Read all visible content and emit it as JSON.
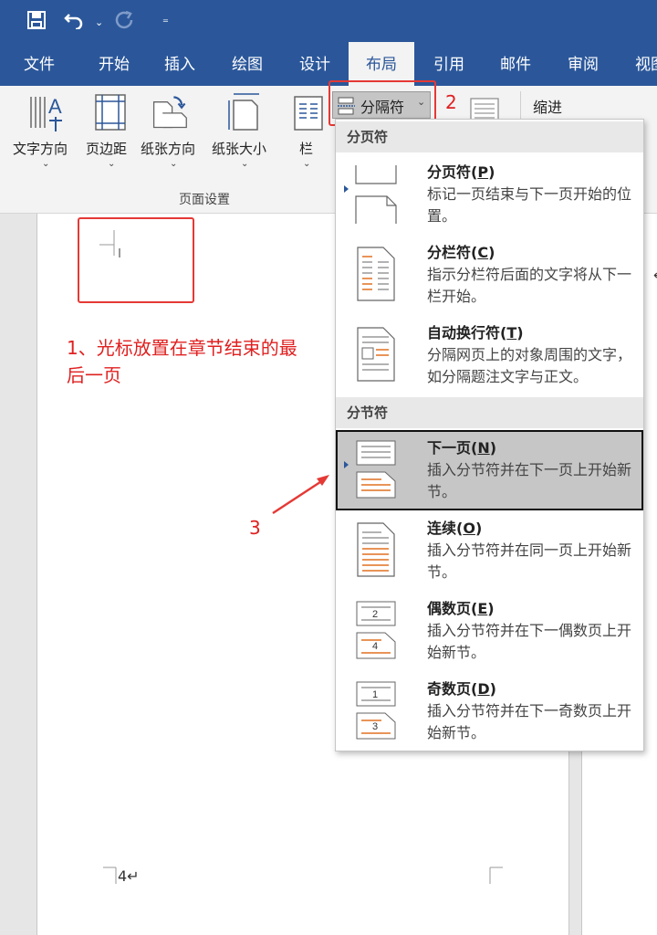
{
  "quick_access": {
    "save_icon": "save-icon",
    "undo_icon": "undo-icon",
    "redo_icon": "redo-icon",
    "customize_icon": "customize-qat-icon"
  },
  "tabs": [
    {
      "label": "文件"
    },
    {
      "label": "开始"
    },
    {
      "label": "插入"
    },
    {
      "label": "绘图"
    },
    {
      "label": "设计"
    },
    {
      "label": "布局"
    },
    {
      "label": "引用"
    },
    {
      "label": "邮件"
    },
    {
      "label": "审阅"
    },
    {
      "label": "视图"
    }
  ],
  "active_tab": "布局",
  "ribbon": {
    "buttons": [
      {
        "label": "文字方向"
      },
      {
        "label": "页边距"
      },
      {
        "label": "纸张方向"
      },
      {
        "label": "纸张大小"
      },
      {
        "label": "栏"
      }
    ],
    "breaks_button": "分隔符",
    "indent_label": "缩进",
    "group_label": "页面设置"
  },
  "annotations": {
    "step1": "1、光标放置在章节结束的最后一页",
    "step2": "2",
    "step3": "3"
  },
  "document": {
    "page_number": "4↵"
  },
  "dropdown": {
    "page_breaks_header": "分页符",
    "section_breaks_header": "分节符",
    "page_break_items": [
      {
        "title": "分页符",
        "key": "P",
        "desc": "标记一页结束与下一页开始的位置。"
      },
      {
        "title": "分栏符",
        "key": "C",
        "desc": "指示分栏符后面的文字将从下一栏开始。"
      },
      {
        "title": "自动换行符",
        "key": "T",
        "desc": "分隔网页上的对象周围的文字，如分隔题注文字与正文。"
      }
    ],
    "section_break_items": [
      {
        "title": "下一页",
        "key": "N",
        "desc": "插入分节符并在下一页上开始新节。",
        "selected": true
      },
      {
        "title": "连续",
        "key": "O",
        "desc": "插入分节符并在同一页上开始新节。"
      },
      {
        "title": "偶数页",
        "key": "E",
        "desc": "插入分节符并在下一偶数页上开始新节。",
        "icon_number": "2",
        "icon_number2": "4"
      },
      {
        "title": "奇数页",
        "key": "D",
        "desc": "插入分节符并在下一奇数页上开始新节。",
        "icon_number": "1",
        "icon_number2": "3"
      }
    ]
  },
  "colors": {
    "title_bar": "#2b579a",
    "annotation_red": "#e02020",
    "accent_orange": "#e07020"
  }
}
